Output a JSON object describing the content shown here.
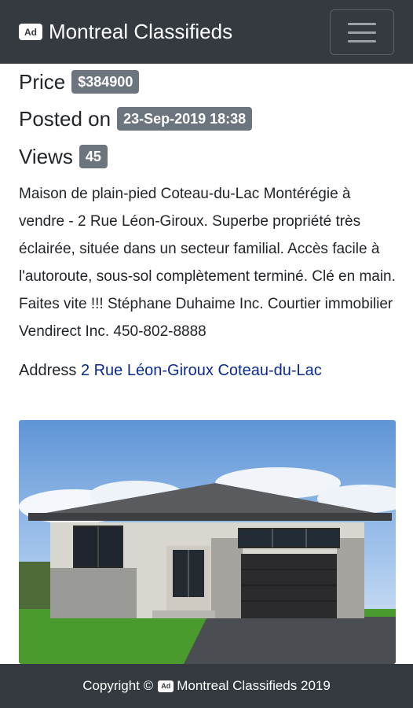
{
  "navbar": {
    "brand_icon": "Ad",
    "brand_name": "Montreal Classifieds",
    "menu_icon": "hamburger-menu-icon"
  },
  "listing": {
    "price_label": "Price",
    "price_value": "$384900",
    "posted_label": "Posted on",
    "posted_value": "23-Sep-2019 18:38",
    "views_label": "Views",
    "views_value": "45",
    "description": "Maison de plain-pied Coteau-du-Lac Montérégie à vendre - 2 Rue Léon-Giroux. Superbe propriété très éclairée, située dans un secteur familial. Accès facile à l'autoroute, sous-sol complètement terminé. Clé en main. Faites vite !!! Stéphane Duhaime Inc. Courtier immobilier Vendirect Inc. 450-802-8888",
    "address_label": "Address",
    "address_link": "2 Rue Léon-Giroux Coteau-du-Lac"
  },
  "footer": {
    "prefix": "Copyright ©",
    "brand_icon": "Ad",
    "text": "Montreal Classifieds 2019"
  },
  "colors": {
    "navbar_bg": "#343a40",
    "badge_bg": "#6c757d",
    "link": "#0a2a8f"
  }
}
